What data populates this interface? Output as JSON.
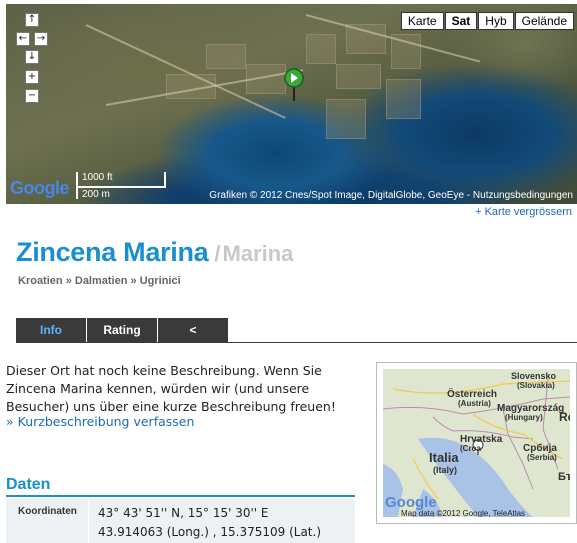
{
  "map": {
    "types": [
      {
        "label": "Karte",
        "active": false
      },
      {
        "label": "Sat",
        "active": true
      },
      {
        "label": "Hyb",
        "active": false
      },
      {
        "label": "Gelände",
        "active": false
      }
    ],
    "controls": {
      "pan_up": "↑",
      "pan_left": "←",
      "pan_right": "→",
      "pan_down": "↓",
      "zoom_in": "+",
      "zoom_out": "−"
    },
    "scale": {
      "imperial": "1000 ft",
      "metric": "200 m"
    },
    "logo": "Google",
    "copyright": "Grafiken © 2012 Cnes/Spot Image, DigitalGlobe, GeoEye - Nutzungsbedingungen",
    "enlarge_link": "+ Karte vergrössern"
  },
  "page": {
    "title": "Zincena Marina",
    "separator": "/",
    "category": "Marina"
  },
  "breadcrumb": [
    {
      "label": "Kroatien"
    },
    {
      "label": "Dalmatien"
    },
    {
      "label": "Ugrinici"
    }
  ],
  "breadcrumb_sep": "»",
  "tabs": [
    {
      "label": "Info",
      "active": true
    },
    {
      "label": "Rating",
      "active": false
    },
    {
      "label": "<",
      "active": false
    }
  ],
  "description": {
    "text": "Dieser Ort hat noch keine Beschreibung. Wenn Sie Zincena Marina kennen, würden wir (und unsere Besucher) uns über eine kurze Beschreibung freuen!",
    "link": "» Kurzbeschreibung verfassen"
  },
  "minimap": {
    "labels": {
      "austria": "Österreich",
      "austria_sub": "(Austria)",
      "hungary": "Magyarország",
      "hungary_sub": "(Hungary)",
      "slovenia": "Slovensko",
      "slovenia_sub": "(Slovakia)",
      "croatia": "Hrvatska",
      "croatia_sub": "(Croa",
      "serbia": "Србија",
      "serbia_sub": "(Serbia)",
      "italy": "Italia",
      "italy_sub": "(Italy)",
      "ro": "Ro",
      "bg": "Бъ"
    },
    "logo": "Google",
    "attribution": "Map data ©2012 Google, TeleAtlas"
  },
  "data": {
    "heading": "Daten",
    "rows": [
      {
        "key": "Koordinaten",
        "value_dms": "43° 43' 51'' N, 15° 15' 30'' E",
        "value_decimal": "43.914063 (Long.) , 15.375109 (Lat.)"
      }
    ]
  }
}
